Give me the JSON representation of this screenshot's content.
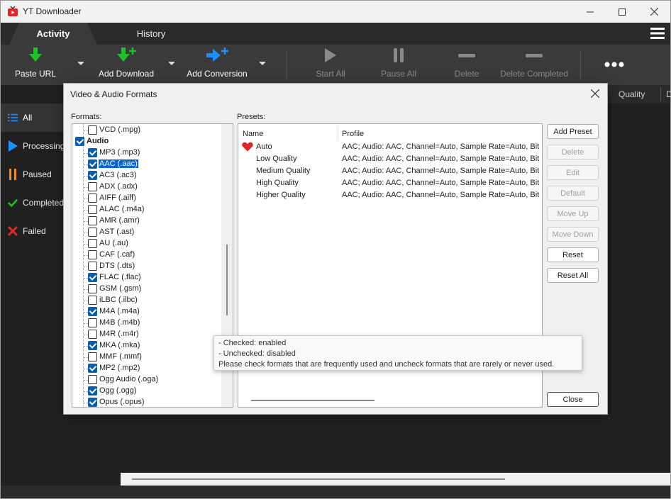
{
  "window": {
    "title": "YT Downloader"
  },
  "tabs": [
    {
      "label": "Activity"
    },
    {
      "label": "History"
    }
  ],
  "toolbar": {
    "paste_url": "Paste URL",
    "add_download": "Add Download",
    "add_conversion": "Add Conversion",
    "start_all": "Start All",
    "pause_all": "Pause All",
    "delete": "Delete",
    "delete_completed": "Delete Completed"
  },
  "sidebar": {
    "items": [
      {
        "label": "All"
      },
      {
        "label": "Processing"
      },
      {
        "label": "Paused"
      },
      {
        "label": "Completed"
      },
      {
        "label": "Failed"
      }
    ]
  },
  "columns": {
    "quality": "Quality",
    "next": "D"
  },
  "dialog": {
    "title": "Video & Audio Formats",
    "formats_label": "Formats:",
    "presets_label": "Presets:",
    "formats": [
      {
        "label": "VCD (.mpg)",
        "checked": false
      },
      {
        "label": "Audio",
        "group": true,
        "checked": true
      },
      {
        "label": "MP3 (.mp3)",
        "checked": true
      },
      {
        "label": "AAC (.aac)",
        "checked": true,
        "selected": true
      },
      {
        "label": "AC3 (.ac3)",
        "checked": true
      },
      {
        "label": "ADX (.adx)",
        "checked": false
      },
      {
        "label": "AIFF (.aiff)",
        "checked": false
      },
      {
        "label": "ALAC (.m4a)",
        "checked": false
      },
      {
        "label": "AMR (.amr)",
        "checked": false
      },
      {
        "label": "AST (.ast)",
        "checked": false
      },
      {
        "label": "AU (.au)",
        "checked": false
      },
      {
        "label": "CAF (.caf)",
        "checked": false
      },
      {
        "label": "DTS (.dts)",
        "checked": false
      },
      {
        "label": "FLAC (.flac)",
        "checked": true
      },
      {
        "label": "GSM (.gsm)",
        "checked": false
      },
      {
        "label": "iLBC (.ilbc)",
        "checked": false
      },
      {
        "label": "M4A (.m4a)",
        "checked": true
      },
      {
        "label": "M4B (.m4b)",
        "checked": false
      },
      {
        "label": "M4R (.m4r)",
        "checked": false
      },
      {
        "label": "MKA (.mka)",
        "checked": true
      },
      {
        "label": "MMF (.mmf)",
        "checked": false
      },
      {
        "label": "MP2 (.mp2)",
        "checked": true
      },
      {
        "label": "Ogg Audio (.oga)",
        "checked": false
      },
      {
        "label": "Ogg (.ogg)",
        "checked": true
      },
      {
        "label": "Opus (.opus)",
        "checked": true
      }
    ],
    "presets_header": {
      "name": "Name",
      "profile": "Profile"
    },
    "presets": [
      {
        "name": "Auto",
        "profile": "AAC; Audio: AAC, Channel=Auto, Sample Rate=Auto, Bit",
        "favorite": true
      },
      {
        "name": "Low Quality",
        "profile": "AAC; Audio: AAC, Channel=Auto, Sample Rate=Auto, Bit"
      },
      {
        "name": "Medium Quality",
        "profile": "AAC; Audio: AAC, Channel=Auto, Sample Rate=Auto, Bit"
      },
      {
        "name": "High Quality",
        "profile": "AAC; Audio: AAC, Channel=Auto, Sample Rate=Auto, Bit"
      },
      {
        "name": "Higher Quality",
        "profile": "AAC; Audio: AAC, Channel=Auto, Sample Rate=Auto, Bit"
      }
    ],
    "buttons": {
      "add_preset": "Add Preset",
      "delete": "Delete",
      "edit": "Edit",
      "default": "Default",
      "move_up": "Move Up",
      "move_down": "Move Down",
      "reset": "Reset",
      "reset_all": "Reset All",
      "close": "Close"
    },
    "tooltip": [
      "- Checked: enabled",
      "- Unchecked: disabled",
      "Please check formats that are frequently used and uncheck formats that are rarely or never used."
    ]
  },
  "colors": {
    "accent": "#0b5cad",
    "green": "#1fbf2a",
    "blue": "#1e8fff",
    "red": "#e0262b",
    "orange": "#f08a24"
  }
}
